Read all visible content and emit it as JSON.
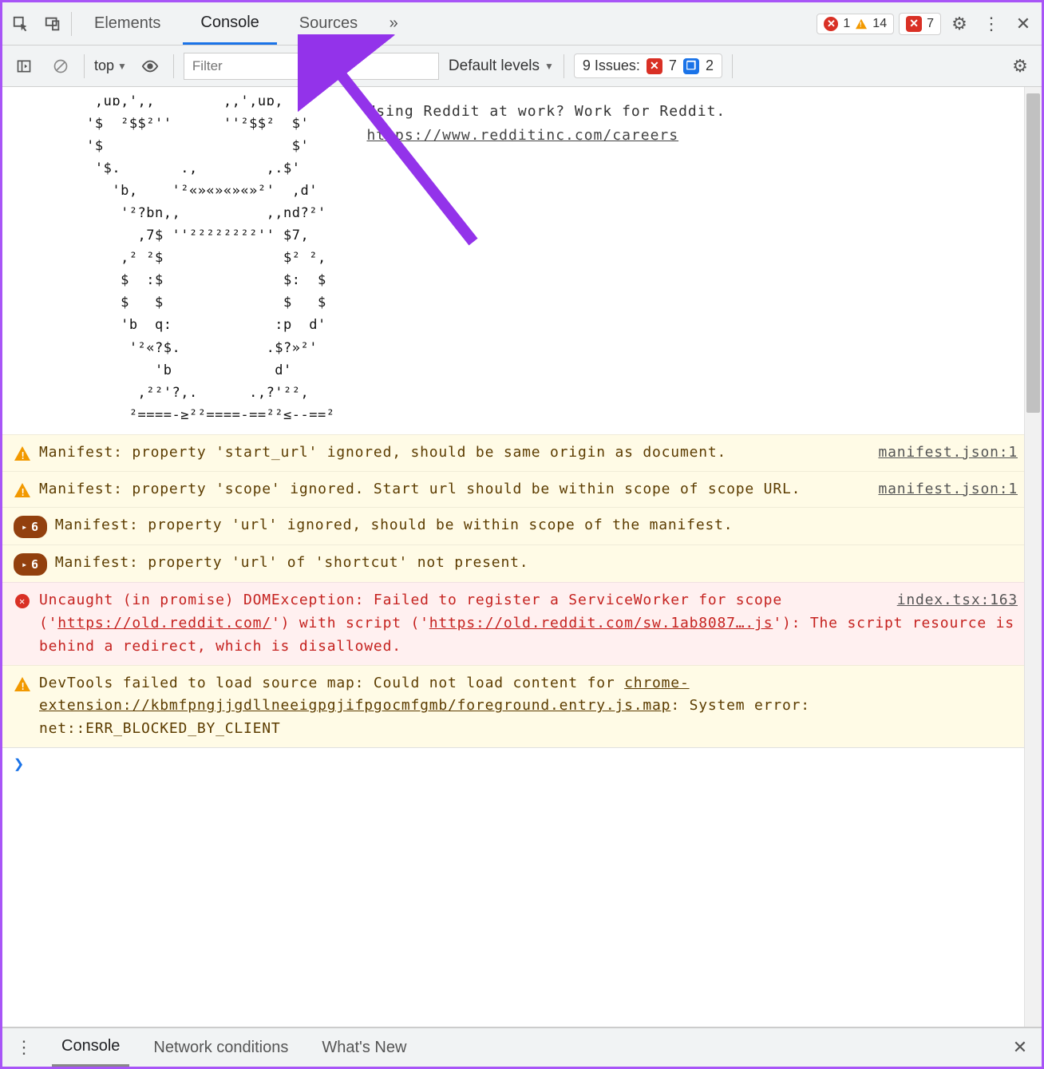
{
  "topTabs": {
    "elements": "Elements",
    "console": "Console",
    "sources": "Sources"
  },
  "topCounts": {
    "errors": "1",
    "warnings": "14",
    "messages": "7"
  },
  "subbar": {
    "context": "top",
    "filterPlaceholder": "Filter",
    "levels": "Default levels",
    "issuesLabel": "9 Issues:",
    "issuesErr": "7",
    "issuesInfo": "2"
  },
  "ascii": {
    "art": "        ,uɒ,',,        ,,',uɒ,\n       '$  ²$$²''      ''²$$²  $'\n       '$                      $'\n        '$.       .,        ,.$'\n          'b,    '²«»«»«»«»²'  ,d'\n           '²?bn,,          ,,nd?²'\n             ,7$ ''²²²²²²²²'' $7,\n           ,² ²$              $² ²,\n           $  :$              $:  $\n           $   $              $   $\n           'b  q:            :p  d'\n            '²«?$.          .$?»²'\n               'b            d'\n             ,²²'?,.      .,?'²²,\n            ²====-≥²²====-==²²≤--==²",
    "line1": "Using Reddit at work? Work for Reddit.",
    "link": "https://www.redditinc.com/careers"
  },
  "messages": [
    {
      "type": "warn",
      "icon": "tri",
      "text": "Manifest: property 'start_url' ignored, should be same origin as document.",
      "src": "manifest.json:1"
    },
    {
      "type": "warn",
      "icon": "tri",
      "text": "Manifest: property 'scope' ignored. Start url should be within scope of scope URL.",
      "src": "manifest.json:1"
    },
    {
      "type": "warn",
      "icon": "pill",
      "count": "6",
      "text": "Manifest: property 'url' ignored, should be within scope of the manifest.",
      "src": ""
    },
    {
      "type": "warn",
      "icon": "pill",
      "count": "6",
      "text": "Manifest: property 'url' of 'shortcut' not present.",
      "src": ""
    },
    {
      "type": "err",
      "icon": "circ",
      "html": "Uncaught (in promise) DOMException: Failed to register a ServiceWorker for scope ('<span class='u'>https://old.reddit.com/</span>') with script ('<span class='u'>https://old.reddit.com/sw.1ab8087….js</span>'): The script resource is behind a redirect, which is disallowed.",
      "src": "index.tsx:163"
    },
    {
      "type": "warn",
      "icon": "tri",
      "html": "DevTools failed to load source map: Could not load content for <span class='u'>chrome-extension://kbmfpngjjgdllneeigpgjifpgocmfgmb/foreground.entry.js.map</span>: System error: net::ERR_BLOCKED_BY_CLIENT",
      "src": ""
    }
  ],
  "drawerTabs": {
    "console": "Console",
    "network": "Network conditions",
    "whatsnew": "What's New"
  }
}
